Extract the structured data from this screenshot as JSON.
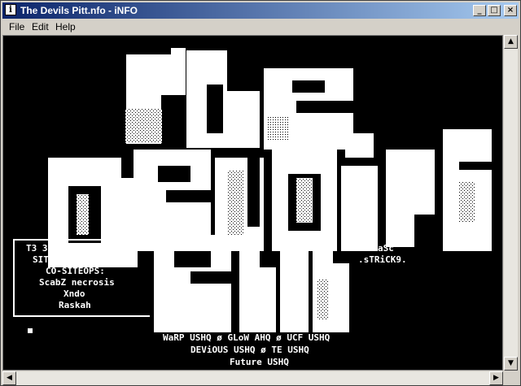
{
  "window": {
    "title": "The Devils Pitt.nfo - iNFO",
    "icon": "info-icon"
  },
  "title_buttons": {
    "minimize": "_",
    "maximize": "□",
    "close": "×"
  },
  "menu": [
    {
      "label": "File"
    },
    {
      "label": "Edit"
    },
    {
      "label": "Help"
    }
  ],
  "nfo": {
    "site_info": [
      "T3 34GB 0day/ISO",
      "SITEOP: HSOBIC",
      "CO-SITEOPS:",
      "ScabZ necrosis",
      "Xndo",
      "Raskah"
    ],
    "credit": [
      "aSc",
      ".sTRiCK9."
    ],
    "affils": [
      "WaRP USHQ ø GLoW AHQ ø UCF USHQ",
      "DEViOUS USHQ ø TE USHQ",
      "Future USHQ"
    ]
  },
  "colors": {
    "nfo_background": "#000000",
    "nfo_text": "#ffffff",
    "titlebar_start": "#0a246a",
    "titlebar_end": "#a6caf0"
  }
}
